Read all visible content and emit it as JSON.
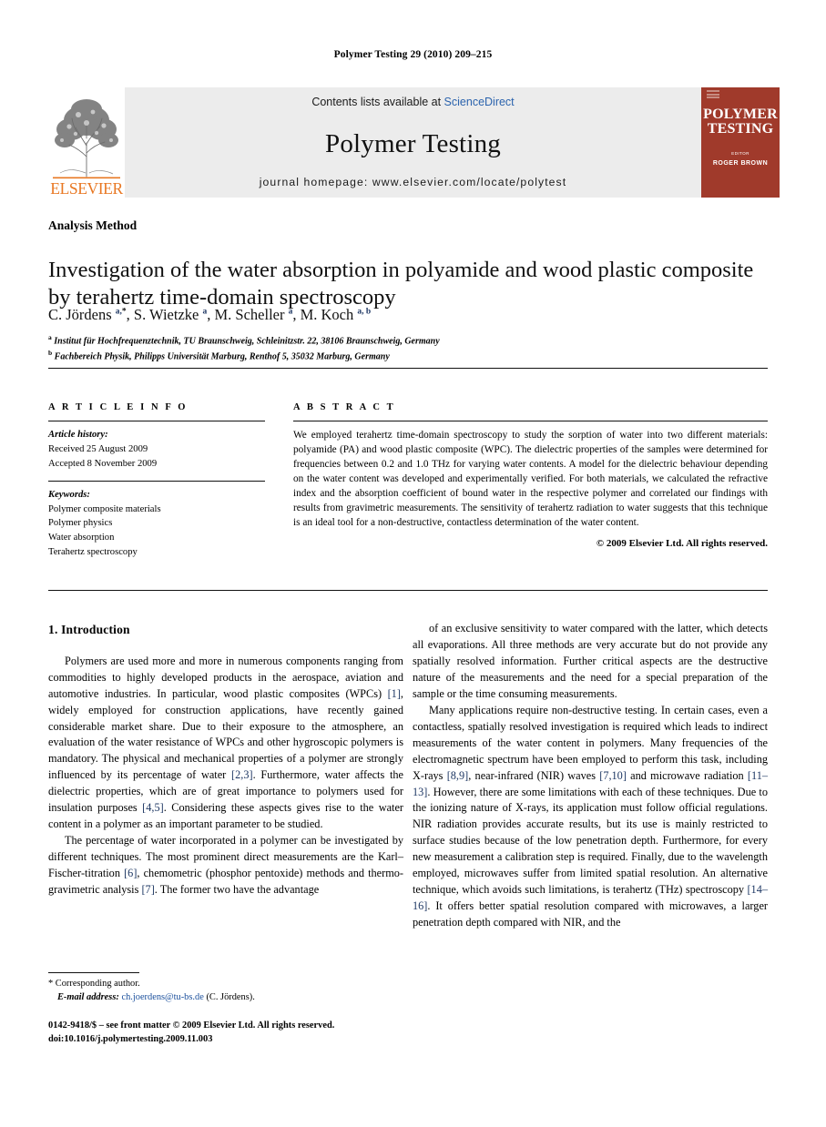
{
  "running_head": "Polymer Testing 29 (2010) 209–215",
  "masthead": {
    "publisher_wordmark": "ELSEVIER",
    "contents_prefix": "Contents lists available at ",
    "contents_link": "ScienceDirect",
    "journal_title": "Polymer Testing",
    "homepage": "journal homepage: www.elsevier.com/locate/polytest",
    "cover": {
      "title_line1": "POLYMER",
      "title_line2": "TESTING",
      "editor_label": "EDITOR",
      "editor_name": "ROGER BROWN",
      "background_color": "#a03a2b"
    }
  },
  "article": {
    "kicker": "Analysis Method",
    "title": "Investigation of the water absorption in polyamide and wood plastic composite by terahertz time-domain spectroscopy",
    "authors_html": "C. Jördens <sup>a,</sup><sup class=\"star\">*</sup>, S. Wietzke <sup>a</sup>, M. Scheller <sup>a</sup>, M. Koch <sup>a, b</sup>",
    "affiliations": [
      {
        "marker": "a",
        "text": "Institut für Hochfrequenztechnik, TU Braunschweig, Schleinitzstr. 22, 38106 Braunschweig, Germany"
      },
      {
        "marker": "b",
        "text": "Fachbereich Physik, Philipps Universität Marburg, Renthof 5, 35032 Marburg, Germany"
      }
    ]
  },
  "info": {
    "heading": "A R T I C L E   I N F O",
    "history_label": "Article history:",
    "history": [
      "Received 25 August 2009",
      "Accepted 8 November 2009"
    ],
    "keywords_label": "Keywords:",
    "keywords": [
      "Polymer composite materials",
      "Polymer physics",
      "Water absorption",
      "Terahertz spectroscopy"
    ]
  },
  "abstract": {
    "heading": "A B S T R A C T",
    "text": "We employed terahertz time-domain spectroscopy to study the sorption of water into two different materials: polyamide (PA) and wood plastic composite (WPC). The dielectric properties of the samples were determined for frequencies between 0.2 and 1.0 THz for varying water contents. A model for the dielectric behaviour depending on the water content was developed and experimentally verified. For both materials, we calculated the refractive index and the absorption coefficient of bound water in the respective polymer and correlated our findings with results from gravimetric measurements. The sensitivity of terahertz radiation to water suggests that this technique is an ideal tool for a non-destructive, contactless determination of the water content.",
    "copyright": "© 2009 Elsevier Ltd. All rights reserved."
  },
  "body": {
    "section_heading": "1. Introduction",
    "left_paragraphs_html": [
      "Polymers are used more and more in numerous components ranging from commodities to highly developed products in the aerospace, aviation and automotive industries. In particular, wood plastic composites (WPCs) <span class=\"ref\">[1]</span>, widely employed for construction applications, have recently gained considerable market share. Due to their exposure to the atmosphere, an evaluation of the water resistance of WPCs and other hygroscopic polymers is mandatory. The physical and mechanical properties of a polymer are strongly influenced by its percentage of water <span class=\"ref\">[2,3]</span>. Furthermore, water affects the dielectric properties, which are of great importance to polymers used for insulation purposes <span class=\"ref\">[4,5]</span>. Considering these aspects gives rise to the water content in a polymer as an important parameter to be studied.",
      "The percentage of water incorporated in a polymer can be investigated by different techniques. The most prominent direct measurements are the Karl–Fischer-titration <span class=\"ref\">[6]</span>, chemometric (phosphor pentoxide) methods and thermo-gravimetric analysis <span class=\"ref\">[7]</span>. The former two have the advantage"
    ],
    "right_paragraphs_html": [
      "of an exclusive sensitivity to water compared with the latter, which detects all evaporations. All three methods are very accurate but do not provide any spatially resolved information. Further critical aspects are the destructive nature of the measurements and the need for a special preparation of the sample or the time consuming measurements.",
      "Many applications require non-destructive testing. In certain cases, even a contactless, spatially resolved investigation is required which leads to indirect measurements of the water content in polymers. Many frequencies of the electromagnetic spectrum have been employed to perform this task, including X-rays <span class=\"ref\">[8,9]</span>, near-infrared (NIR) waves <span class=\"ref\">[7,10]</span> and microwave radiation <span class=\"ref\">[11–13]</span>. However, there are some limitations with each of these techniques. Due to the ionizing nature of X-rays, its application must follow official regulations. NIR radiation provides accurate results, but its use is mainly restricted to surface studies because of the low penetration depth. Furthermore, for every new measurement a calibration step is required. Finally, due to the wavelength employed, microwaves suffer from limited spatial resolution. An alternative technique, which avoids such limitations, is terahertz (THz) spectroscopy <span class=\"ref\">[14–16]</span>. It offers better spatial resolution compared with microwaves, a larger penetration depth compared with NIR, and the"
    ]
  },
  "footnote": {
    "corresponding": "* Corresponding author.",
    "email_label": "E-mail address:",
    "email": "ch.joerdens@tu-bs.de",
    "email_owner": "(C. Jördens)."
  },
  "page_footer": {
    "front_matter": "0142-9418/$ – see front matter © 2009 Elsevier Ltd. All rights reserved.",
    "doi": "doi:10.1016/j.polymertesting.2009.11.003"
  }
}
